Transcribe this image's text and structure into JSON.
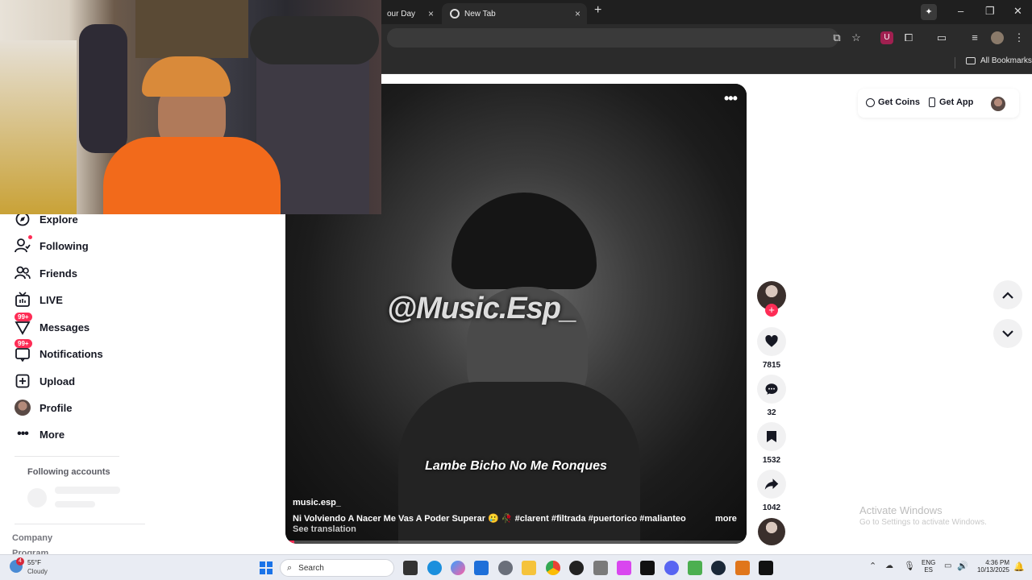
{
  "browser": {
    "tabs": [
      {
        "title": "our Day"
      },
      {
        "title": "New Tab"
      }
    ],
    "new_tab": "+",
    "bookmarks_label": "All Bookmarks",
    "window_controls": [
      "–",
      "❐",
      "✕"
    ]
  },
  "header": {
    "get_coins": "Get Coins",
    "get_app": "Get App"
  },
  "sidebar": {
    "items": [
      {
        "label": "Explore",
        "icon": "compass-icon"
      },
      {
        "label": "Following",
        "icon": "following-icon"
      },
      {
        "label": "Friends",
        "icon": "friends-icon"
      },
      {
        "label": "LIVE",
        "icon": "live-icon"
      },
      {
        "label": "Messages",
        "icon": "messages-icon",
        "badge": "99+"
      },
      {
        "label": "Notifications",
        "icon": "notifications-icon",
        "badge": "99+"
      },
      {
        "label": "Upload",
        "icon": "upload-icon"
      },
      {
        "label": "Profile",
        "icon": "avatar"
      },
      {
        "label": "More",
        "icon": "more-icon"
      }
    ],
    "following_accounts": "Following accounts",
    "footer": "Company",
    "footer_cut": "Program"
  },
  "video": {
    "watermark": "@Music.Esp_",
    "caption_overlay": "Lambe Bicho No Me Ronques",
    "author": "music.esp_",
    "description": "Ni Volviendo A Nacer Me Vas A Poder Superar 🥲 🥀 #clarent #filtrada #puertorico #malianteo ...",
    "more": "more",
    "see_translation": "See translation",
    "progress": 0.02
  },
  "actions": {
    "likes": "7815",
    "comments": "32",
    "saves": "1532",
    "shares": "1042"
  },
  "watermark_windows": {
    "line1": "Activate Windows",
    "line2": "Go to Settings to activate Windows."
  },
  "taskbar": {
    "weather_temp": "55°F",
    "weather_desc": "Cloudy",
    "weather_badge": "4",
    "search": "Search",
    "lang1": "ENG",
    "lang2": "ES",
    "time": "4:36 PM",
    "date": "10/13/2025"
  },
  "colors": {
    "accent": "#fe2c55",
    "text": "#161823"
  }
}
